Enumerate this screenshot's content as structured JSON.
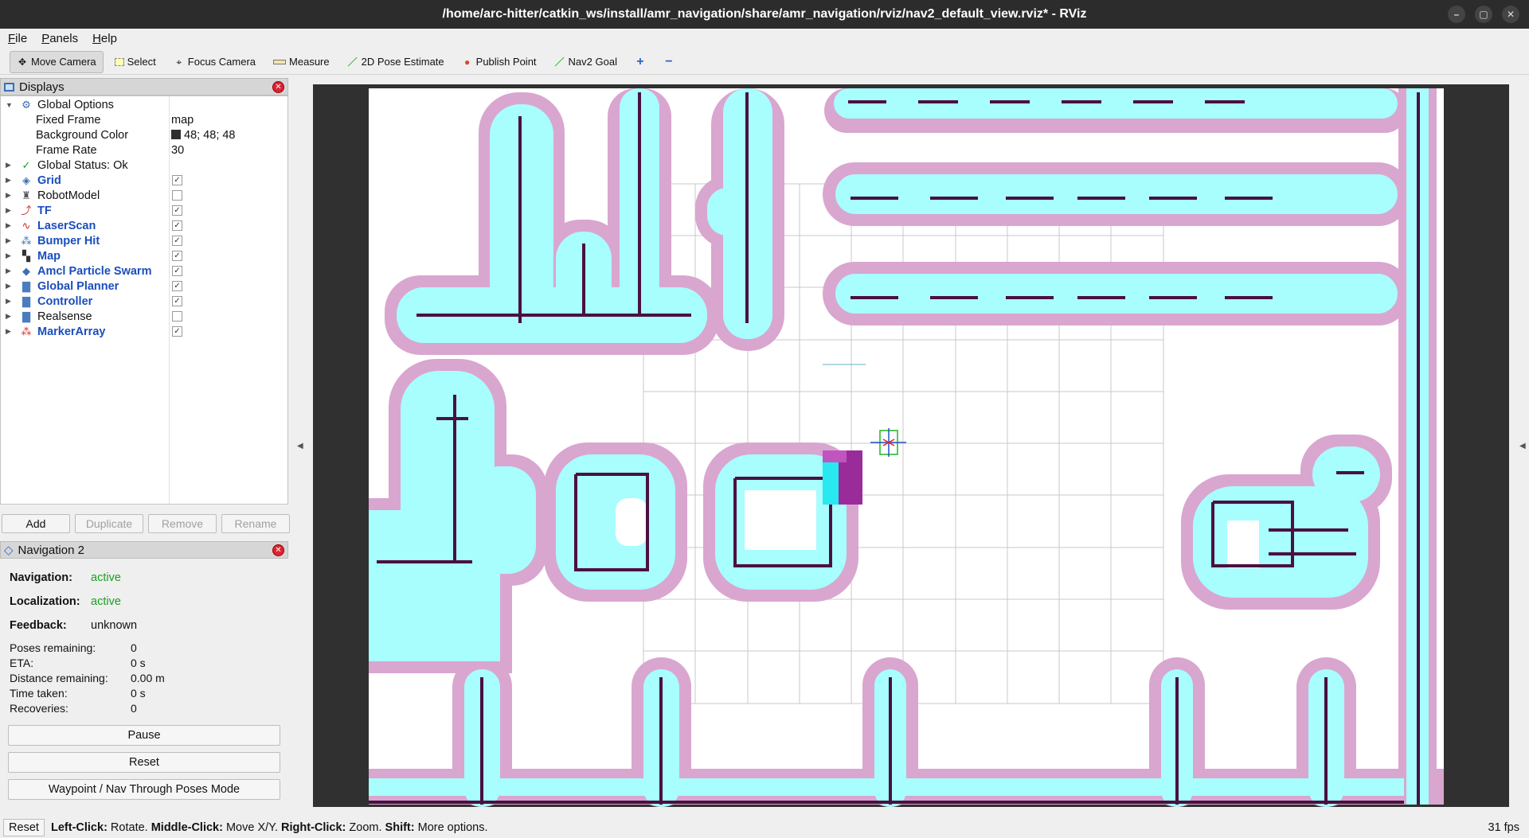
{
  "window": {
    "title": "/home/arc-hitter/catkin_ws/install/amr_navigation/share/amr_navigation/rviz/nav2_default_view.rviz* - RViz",
    "controls": [
      "–",
      "▢",
      "✕"
    ]
  },
  "menu": [
    "File",
    "Panels",
    "Help"
  ],
  "toolbar": [
    {
      "label": "Move Camera",
      "icon": "move-camera-icon",
      "active": true
    },
    {
      "label": "Select",
      "icon": "select-icon"
    },
    {
      "label": "Focus Camera",
      "icon": "focus-camera-icon"
    },
    {
      "label": "Measure",
      "icon": "measure-icon"
    },
    {
      "label": "2D Pose Estimate",
      "icon": "pose-estimate-icon",
      "color": "#2fb52f"
    },
    {
      "label": "Publish Point",
      "icon": "publish-point-icon",
      "color": "#e0452b"
    },
    {
      "label": "Nav2 Goal",
      "icon": "nav2-goal-icon",
      "color": "#2fb52f"
    }
  ],
  "displays": {
    "title": "Displays",
    "global_options": "Global Options",
    "options": [
      {
        "key": "Fixed Frame",
        "value": "map"
      },
      {
        "key": "Background Color",
        "value": "48; 48; 48"
      },
      {
        "key": "Frame Rate",
        "value": "30"
      }
    ],
    "global_status": "Global Status: Ok",
    "items": [
      {
        "label": "Grid",
        "checked": true,
        "icon": "grid-icon"
      },
      {
        "label": "RobotModel",
        "checked": false,
        "icon": "robot-model-icon"
      },
      {
        "label": "TF",
        "checked": true,
        "icon": "tf-icon"
      },
      {
        "label": "LaserScan",
        "checked": true,
        "icon": "laser-scan-icon"
      },
      {
        "label": "Bumper Hit",
        "checked": true,
        "icon": "bumper-hit-icon"
      },
      {
        "label": "Map",
        "checked": true,
        "icon": "map-icon"
      },
      {
        "label": "Amcl Particle Swarm",
        "checked": true,
        "icon": "particle-swarm-icon"
      },
      {
        "label": "Global Planner",
        "checked": true,
        "icon": "folder-icon"
      },
      {
        "label": "Controller",
        "checked": true,
        "icon": "folder-icon"
      },
      {
        "label": "Realsense",
        "checked": false,
        "icon": "folder-icon"
      },
      {
        "label": "MarkerArray",
        "checked": true,
        "icon": "marker-array-icon"
      }
    ],
    "buttons": {
      "add": "Add",
      "duplicate": "Duplicate",
      "remove": "Remove",
      "rename": "Rename"
    }
  },
  "nav2": {
    "title": "Navigation 2",
    "navigation_label": "Navigation:",
    "navigation_value": "active",
    "localization_label": "Localization:",
    "localization_value": "active",
    "feedback_label": "Feedback:",
    "feedback_value": "unknown",
    "stats": [
      {
        "k": "Poses remaining:",
        "v": "0"
      },
      {
        "k": "ETA:",
        "v": "0 s"
      },
      {
        "k": "Distance remaining:",
        "v": "0.00 m"
      },
      {
        "k": "Time taken:",
        "v": "0 s"
      },
      {
        "k": "Recoveries:",
        "v": "0"
      }
    ],
    "pause": "Pause",
    "reset": "Reset",
    "waypoint": "Waypoint / Nav Through Poses Mode"
  },
  "status": {
    "reset": "Reset",
    "hint_parts": [
      {
        "b": "Left-Click:",
        "t": " Rotate. "
      },
      {
        "b": "Middle-Click:",
        "t": " Move X/Y. "
      },
      {
        "b": "Right-Click:",
        "t": " Zoom. "
      },
      {
        "b": "Shift:",
        "t": " More options."
      }
    ],
    "fps": "31 fps"
  },
  "colors": {
    "background": "#303030",
    "map_free": "#ffffff",
    "wall": "#4a1040",
    "inflation_outer": "#d9a6cf",
    "inflation_inner": "#a8fdfd"
  }
}
